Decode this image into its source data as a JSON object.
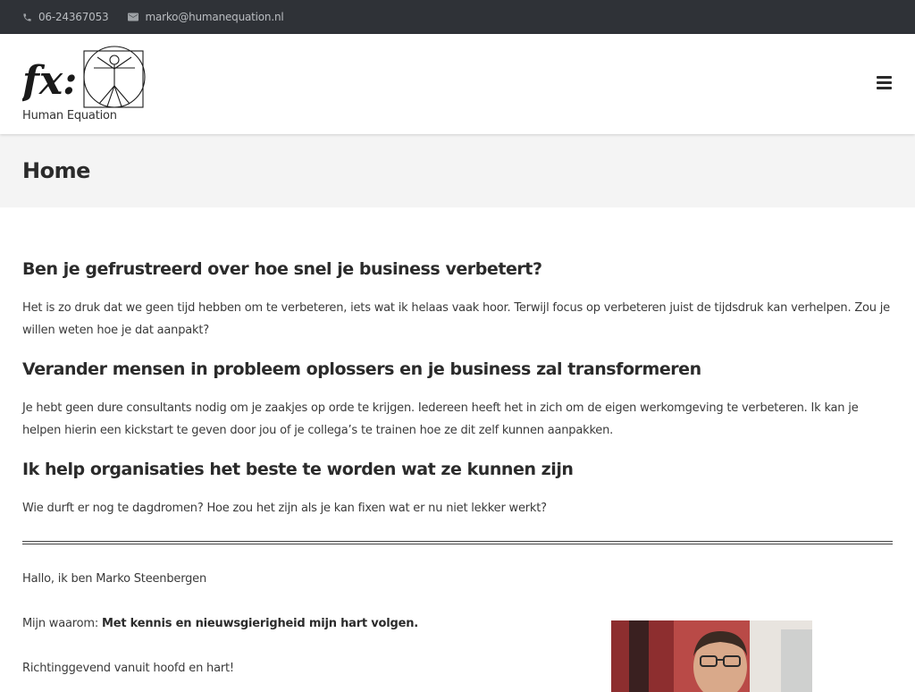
{
  "topbar": {
    "phone": "06-24367053",
    "email": "marko@humanequation.nl"
  },
  "header": {
    "logo_text": "fx:",
    "logo_caption": "Human Equation"
  },
  "page": {
    "title": "Home"
  },
  "sections": [
    {
      "heading": "Ben je gefrustreerd over hoe snel je business verbetert?",
      "body": "Het is zo druk dat we geen tijd hebben om te verbeteren, iets wat ik helaas vaak hoor. Terwijl focus op verbeteren juist de tijdsdruk kan verhelpen. Zou je willen weten hoe je dat aanpakt?"
    },
    {
      "heading": "Verander mensen in probleem oplossers en je business zal transformeren",
      "body": "Je hebt geen dure consultants nodig om je zaakjes op orde te krijgen. Iedereen heeft het in zich om de eigen werkomgeving te verbeteren. Ik kan je helpen hierin een kickstart te geven door jou of je collega’s te trainen hoe ze dit zelf kunnen aanpakken."
    },
    {
      "heading": "Ik help organisaties het beste te worden wat ze kunnen zijn",
      "body": "Wie durft er nog te dagdromen? Hoe zou het zijn als je kan fixen wat er nu niet lekker werkt?"
    }
  ],
  "intro": {
    "greeting": "Hallo, ik ben Marko Steenbergen",
    "why_label": "Mijn waarom: ",
    "why_value": "Met kennis en nieuwsgierigheid mijn hart volgen.",
    "tagline": "Richtinggevend vanuit hoofd en hart!"
  },
  "icons": {
    "phone": "phone-icon",
    "email": "envelope-icon",
    "menu": "hamburger-menu-icon"
  }
}
